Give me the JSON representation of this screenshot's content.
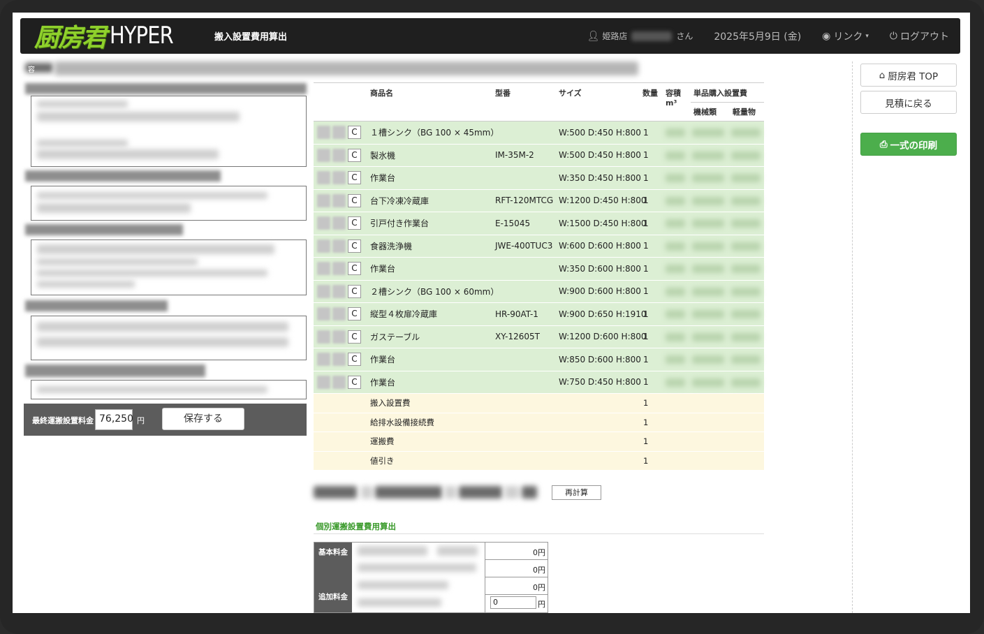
{
  "header": {
    "logo_kanji": "厨房君",
    "logo_hyper": "HYPER",
    "page_title": "搬入設置費用算出",
    "user_store": "姫路店",
    "user_suffix": "さん",
    "date": "2025年5月9日 (金)",
    "link_label": "リンク",
    "logout_label": "ログアウト"
  },
  "left_panel": {
    "container_label": "容",
    "final_label": "最終運搬設置料金",
    "final_value": "76,250",
    "final_unit": "円",
    "save_label": "保存する"
  },
  "table": {
    "headers": {
      "name": "商品名",
      "model": "型番",
      "size": "サイズ",
      "qty": "数量",
      "volume": "容積",
      "volume_unit": "m³",
      "unit_install": "単品購入設置費",
      "machine": "機械類",
      "light": "軽量物"
    },
    "copy_label": "C",
    "items": [
      {
        "name": "１槽シンク（BG 100 × 45mm）",
        "model": "",
        "size": "W:500 D:450 H:800",
        "qty": "1"
      },
      {
        "name": "製氷機",
        "model": "IM-35M-2",
        "size": "W:500 D:450 H:800",
        "qty": "1"
      },
      {
        "name": "作業台",
        "model": "",
        "size": "W:350 D:450 H:800",
        "qty": "1"
      },
      {
        "name": "台下冷凍冷蔵庫",
        "model": "RFT-120MTCG",
        "size": "W:1200 D:450 H:800",
        "qty": "1"
      },
      {
        "name": "引戸付き作業台",
        "model": "E-15045",
        "size": "W:1500 D:450 H:800",
        "qty": "1"
      },
      {
        "name": "食器洗浄機",
        "model": "JWE-400TUC3",
        "size": "W:600 D:600 H:800",
        "qty": "1"
      },
      {
        "name": "作業台",
        "model": "",
        "size": "W:350 D:600 H:800",
        "qty": "1"
      },
      {
        "name": "２槽シンク（BG 100 × 60mm）",
        "model": "",
        "size": "W:900 D:600 H:800",
        "qty": "1"
      },
      {
        "name": "縦型４枚扉冷蔵庫",
        "model": "HR-90AT-1",
        "size": "W:900 D:650 H:1910",
        "qty": "1"
      },
      {
        "name": "ガステーブル",
        "model": "XY-12605T",
        "size": "W:1200 D:600 H:800",
        "qty": "1"
      },
      {
        "name": "作業台",
        "model": "",
        "size": "W:850 D:600 H:800",
        "qty": "1"
      },
      {
        "name": "作業台",
        "model": "",
        "size": "W:750 D:450 H:800",
        "qty": "1"
      }
    ],
    "fees": [
      {
        "name": "搬入設置費",
        "qty": "1"
      },
      {
        "name": "給排水設備接続費",
        "qty": "1"
      },
      {
        "name": "運搬費",
        "qty": "1"
      },
      {
        "name": "値引き",
        "qty": "1"
      }
    ]
  },
  "recalc_label": "再計算",
  "individual": {
    "title": "個別運搬設置費用算出",
    "basic_label": "基本料金",
    "extra_label": "追加料金",
    "values": [
      "0円",
      "0円",
      "0円"
    ],
    "input_value": "0",
    "input_unit": "円"
  },
  "sidebar": {
    "top_label": "厨房君 TOP",
    "back_label": "見積に戻る",
    "print_label": "一式の印刷"
  }
}
